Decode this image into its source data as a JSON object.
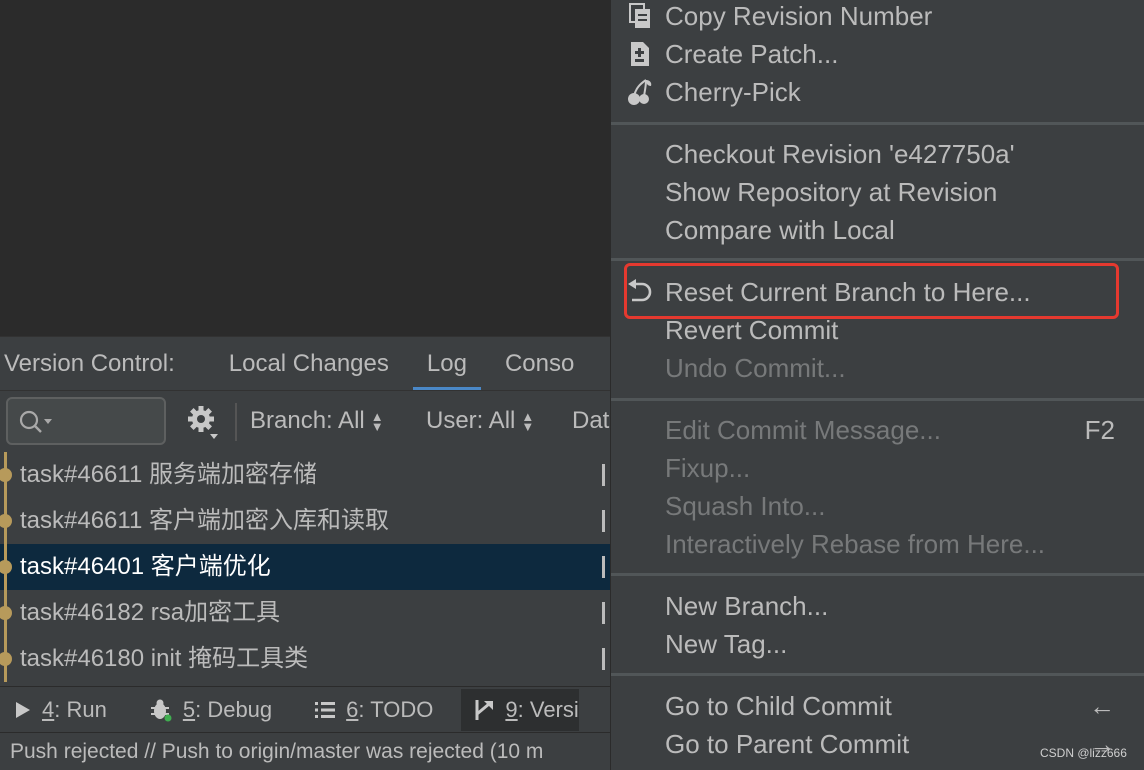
{
  "version_control": {
    "label": "Version Control:",
    "tabs": [
      "Local Changes",
      "Log",
      "Conso"
    ],
    "active_tab": "Log"
  },
  "toolbar": {
    "branch_filter": "Branch: All",
    "user_filter": "User: All",
    "date_filter": "Dat"
  },
  "commits": [
    "task#46611 服务端加密存储",
    "task#46611 客户端加密入库和读取",
    "task#46401 客户端优化",
    "task#46182 rsa加密工具",
    "task#46180 init 掩码工具类"
  ],
  "tool_windows": {
    "run_num": "4",
    "run_label": ": Run",
    "debug_num": "5",
    "debug_label": ": Debug",
    "todo_num": "6",
    "todo_label": ": TODO",
    "vcs_num": "9",
    "vcs_label": ": Versi"
  },
  "status": "Push rejected // Push to origin/master was rejected (10 m",
  "menu": {
    "copy_revision": "Copy Revision Number",
    "create_patch": "Create Patch...",
    "cherry_pick": "Cherry-Pick",
    "checkout_revision": "Checkout Revision 'e427750a'",
    "show_repository": "Show Repository at Revision",
    "compare_local": "Compare with Local",
    "reset_branch": "Reset Current Branch to Here...",
    "revert_commit": "Revert Commit",
    "undo_commit": "Undo Commit...",
    "edit_message": "Edit Commit Message...",
    "edit_message_shortcut": "F2",
    "fixup": "Fixup...",
    "squash": "Squash Into...",
    "rebase": "Interactively Rebase from Here...",
    "new_branch": "New Branch...",
    "new_tag": "New Tag...",
    "child_commit": "Go to Child Commit",
    "child_shortcut": "←",
    "parent_commit": "Go to Parent Commit",
    "parent_shortcut": "→"
  },
  "watermark": "CSDN @lizz666",
  "colors": {
    "highlight": "#e5392f",
    "selection": "#0d293e",
    "tab_underline": "#4a88c7",
    "graph": "#b79a5b"
  }
}
